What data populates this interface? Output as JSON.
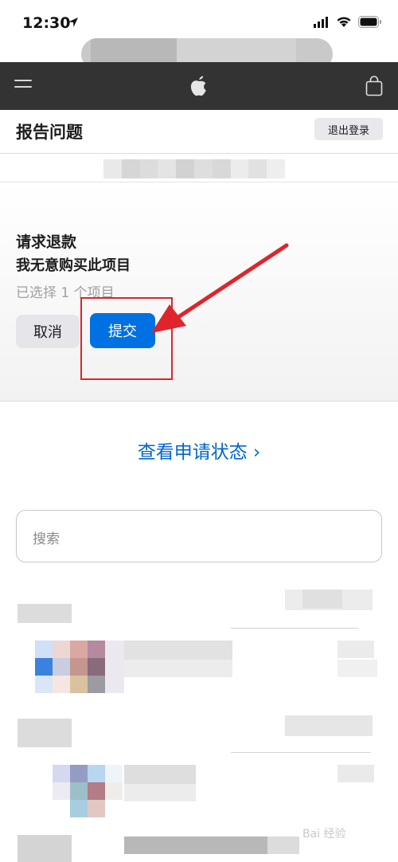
{
  "status_bar": {
    "time": "12:30"
  },
  "nav": {
    "menu_icon": "hamburger-icon",
    "logo_icon": "apple-logo-icon",
    "bag_icon": "shopping-bag-icon"
  },
  "header": {
    "title": "报告问题",
    "signout_label": "退出登录"
  },
  "refund": {
    "title": "请求退款",
    "reason": "我无意购买此项目",
    "selected": "已选择 1 个项目",
    "cancel_label": "取消",
    "submit_label": "提交"
  },
  "links": {
    "view_status": "查看申请状态 ›"
  },
  "search": {
    "placeholder": "搜索"
  },
  "watermark": "Bai 经验",
  "colors": {
    "nav_bg": "#333333",
    "accent": "#0071e3",
    "link": "#0066cc",
    "annotation": "#e0242b"
  }
}
